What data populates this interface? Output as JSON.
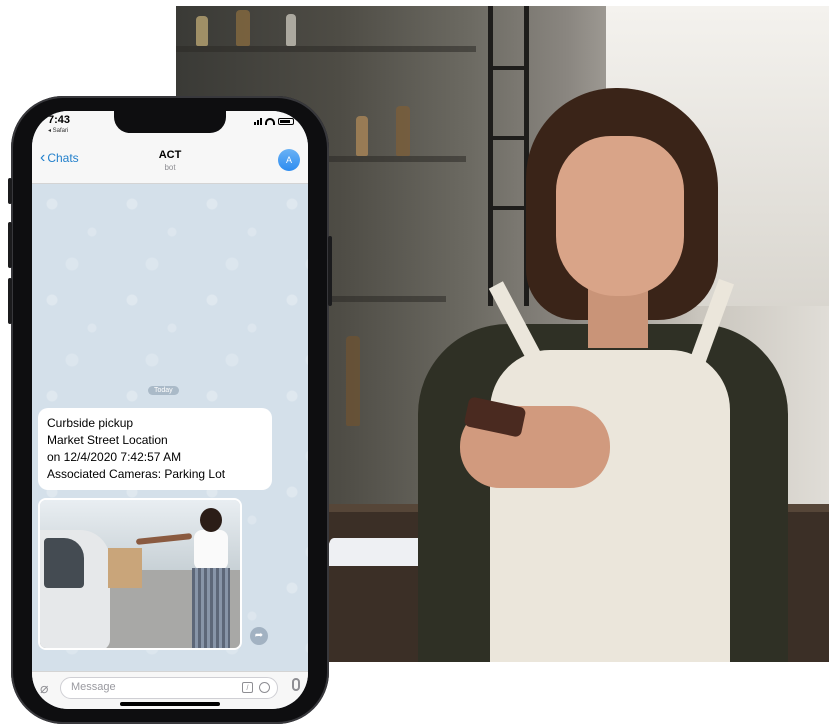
{
  "phone": {
    "status": {
      "time": "7:43",
      "back_app": "◂ Safari"
    },
    "header": {
      "back_label": "Chats",
      "title": "ACT",
      "subtitle": "bot",
      "avatar_letter": "A"
    },
    "chat": {
      "date_separator": "Today",
      "message": {
        "lines": [
          "Curbside pickup",
          "Market Street Location",
          "on 12/4/2020  7:42:57 AM",
          "Associated Cameras: Parking Lot"
        ]
      }
    },
    "input": {
      "placeholder": "Message"
    }
  },
  "colors": {
    "accent": "#2481cc",
    "chat_background": "#d4e0ea",
    "bubble": "#ffffff"
  },
  "icons": [
    "chevron-left-icon",
    "signal-icon",
    "wifi-icon",
    "battery-icon",
    "paperclip-icon",
    "command-icon",
    "clock-icon",
    "microphone-icon",
    "share-icon"
  ]
}
